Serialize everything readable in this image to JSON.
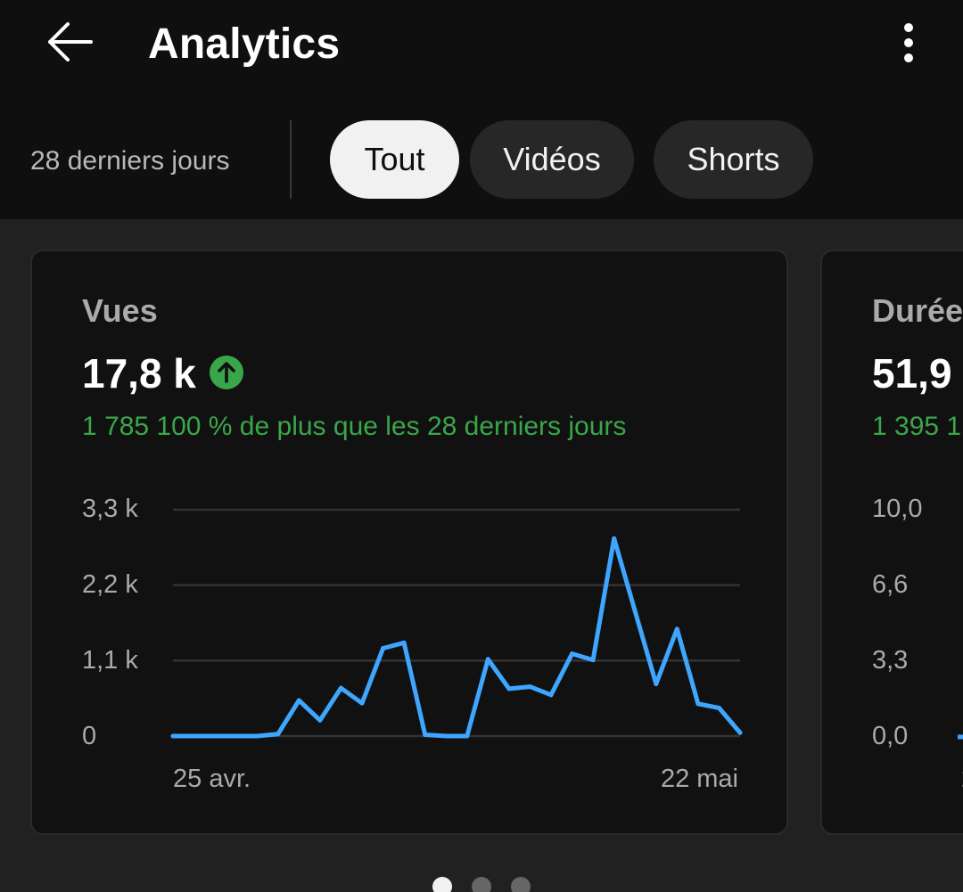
{
  "header": {
    "title": "Analytics",
    "back_icon": "arrow-left-icon",
    "more_icon": "more-vertical-icon"
  },
  "filters": {
    "period": "28 derniers jours",
    "chips": [
      "Tout",
      "Vidéos",
      "Shorts"
    ],
    "active_chip": "Tout"
  },
  "colors": {
    "accent_line": "#3ea6ff",
    "positive": "#3aa64a",
    "background": "#0f0f0f"
  },
  "cards": [
    {
      "label": "Vues",
      "value": "17,8 k",
      "trend_icon": "arrow-up-circle-icon",
      "change": "1 785 100 % de plus que les 28 derniers jours",
      "y_ticks": [
        "3,3 k",
        "2,2 k",
        "1,1 k",
        "0"
      ],
      "x_ticks": [
        "25 avr.",
        "22 mai"
      ]
    },
    {
      "label": "Durée",
      "value": "51,9",
      "change": "1 395 1",
      "y_ticks": [
        "10,0",
        "6,6",
        "3,3",
        "0,0"
      ],
      "x_ticks": [
        "2"
      ]
    }
  ],
  "chart_data": [
    {
      "type": "line",
      "x": [
        "25 avr.",
        "26 avr.",
        "27 avr.",
        "28 avr.",
        "29 avr.",
        "30 avr.",
        "1 mai",
        "2 mai",
        "3 mai",
        "4 mai",
        "5 mai",
        "6 mai",
        "7 mai",
        "8 mai",
        "9 mai",
        "10 mai",
        "11 mai",
        "12 mai",
        "13 mai",
        "14 mai",
        "15 mai",
        "16 mai",
        "17 mai",
        "18 mai",
        "19 mai",
        "20 mai",
        "21 mai",
        "22 mai"
      ],
      "values": [
        0,
        0,
        0,
        0,
        0,
        30,
        520,
        230,
        700,
        480,
        1280,
        1360,
        20,
        0,
        0,
        1120,
        690,
        720,
        600,
        1200,
        1110,
        2880,
        1820,
        760,
        1560,
        470,
        410,
        50
      ],
      "y_ticks": [
        "3,3 k",
        "2,2 k",
        "1,1 k",
        "0"
      ],
      "ylim": [
        0,
        3300
      ],
      "grid": true,
      "color": "#3ea6ff"
    }
  ],
  "pagination": {
    "count": 3,
    "active_index": 0
  }
}
